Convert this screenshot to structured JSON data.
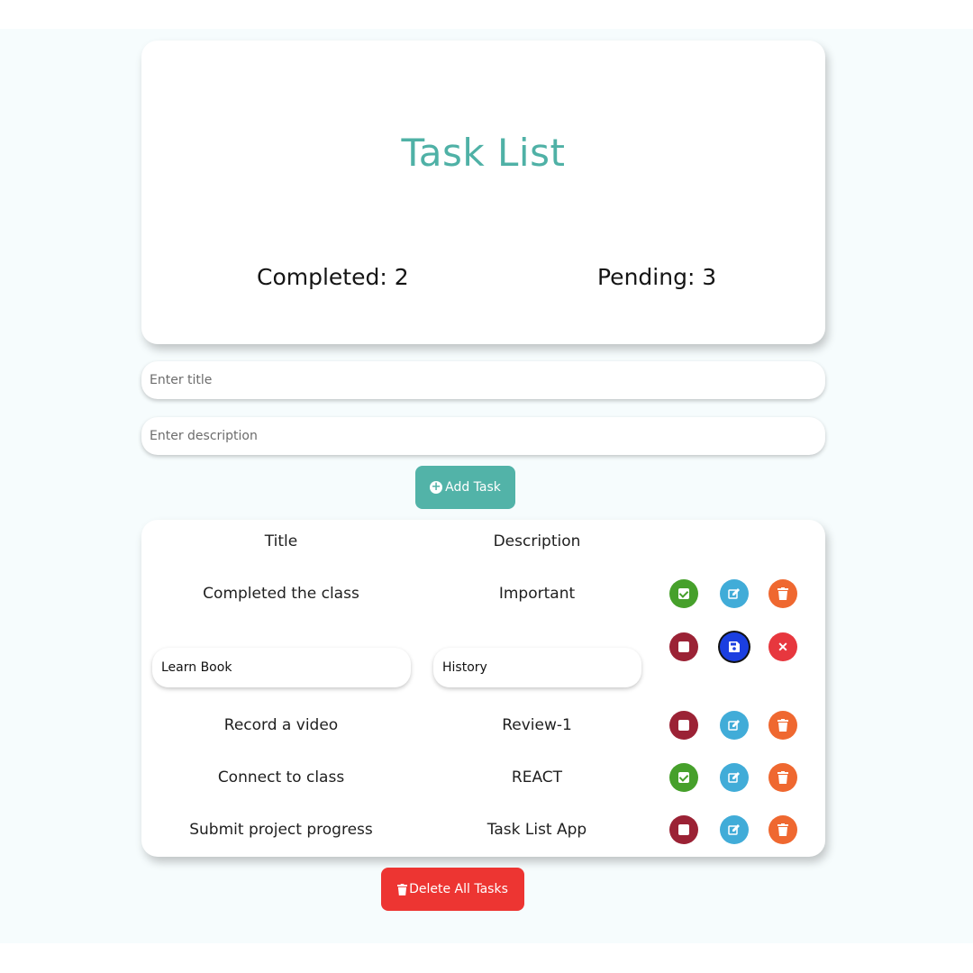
{
  "header": {
    "title": "Task List",
    "completed_text": "Completed: 2",
    "pending_text": "Pending: 3"
  },
  "form": {
    "title_placeholder": "Enter title",
    "description_placeholder": "Enter description",
    "add_label": "Add Task"
  },
  "table": {
    "headers": {
      "title": "Title",
      "description": "Description"
    },
    "rows": [
      {
        "title": "Completed the class",
        "description": "Important",
        "status": "completed",
        "actions": [
          "check-icon",
          "edit-icon",
          "trash-icon"
        ]
      },
      {
        "title": "Learn Book",
        "description": "History",
        "status": "editing",
        "actions": [
          "square-icon",
          "save-icon",
          "close-icon"
        ]
      },
      {
        "title": "Record a video",
        "description": "Review-1",
        "status": "pending",
        "actions": [
          "square-icon",
          "edit-icon",
          "trash-icon"
        ]
      },
      {
        "title": "Connect to class",
        "description": "REACT",
        "status": "completed",
        "actions": [
          "check-icon",
          "edit-icon",
          "trash-icon"
        ]
      },
      {
        "title": "Submit project progress",
        "description": "Task List App",
        "status": "pending",
        "actions": [
          "square-icon",
          "edit-icon",
          "trash-icon"
        ]
      }
    ]
  },
  "footer": {
    "delete_all_label": "Delete All Tasks"
  },
  "colors": {
    "accent": "#52b3a8",
    "complete": "#46a02b",
    "edit": "#41acd8",
    "delete": "#ef6830",
    "pending": "#9b2235",
    "save": "#1b3fe0",
    "cancel": "#e7373e",
    "delete_all": "#ed3532"
  }
}
